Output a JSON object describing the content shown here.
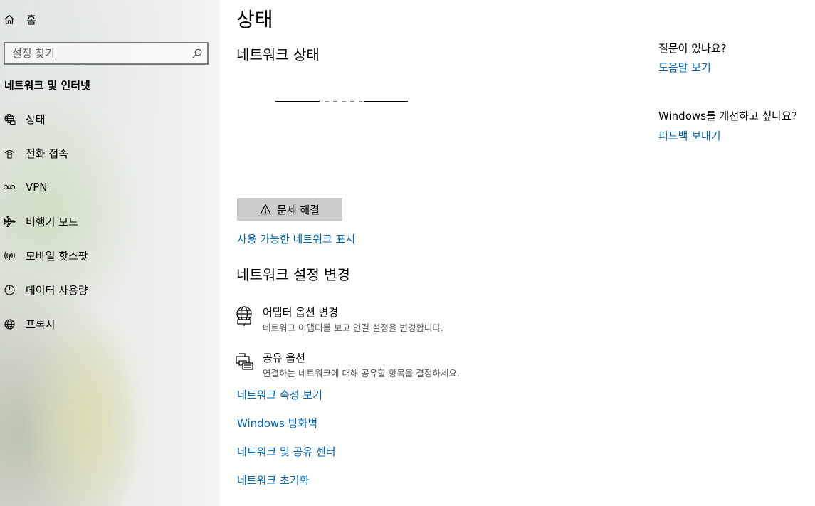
{
  "sidebar": {
    "home_label": "홈",
    "search": {
      "placeholder": "설정 찾기",
      "value": ""
    },
    "section_title": "네트워크 및 인터넷",
    "items": [
      {
        "label": "상태",
        "icon": "globe-status-icon"
      },
      {
        "label": "전화 접속",
        "icon": "dialup-icon"
      },
      {
        "label": "VPN",
        "icon": "vpn-icon"
      },
      {
        "label": "비행기 모드",
        "icon": "airplane-icon"
      },
      {
        "label": "모바일 핫스팟",
        "icon": "hotspot-icon"
      },
      {
        "label": "데이터 사용량",
        "icon": "data-usage-icon"
      },
      {
        "label": "프록시",
        "icon": "globe-icon"
      }
    ]
  },
  "main": {
    "title": "상태",
    "network_status_heading": "네트워크 상태",
    "troubleshoot_label": "문제 해결",
    "show_networks_link": "사용 가능한 네트워크 표시",
    "change_settings_heading": "네트워크 설정 변경",
    "options": [
      {
        "title": "어댑터 옵션 변경",
        "desc": "네트워크 어댑터를 보고 연결 설정을 변경합니다.",
        "icon": "adapter-icon"
      },
      {
        "title": "공유 옵션",
        "desc": "연결하는 네트워크에 대해 공유할 항목을 결정하세요.",
        "icon": "sharing-icon"
      }
    ],
    "links": [
      "네트워크 속성 보기",
      "Windows 방화벽",
      "네트워크 및 공유 센터",
      "네트워크 초기화"
    ]
  },
  "aside": {
    "question": "질문이 있나요?",
    "help_link": "도움말 보기",
    "improve_question": "Windows를 개선하고 싶나요?",
    "feedback_link": "피드백 보내기"
  },
  "colors": {
    "link": "#0067b8",
    "button_bg": "#cccccc",
    "description_text": "#555555"
  }
}
